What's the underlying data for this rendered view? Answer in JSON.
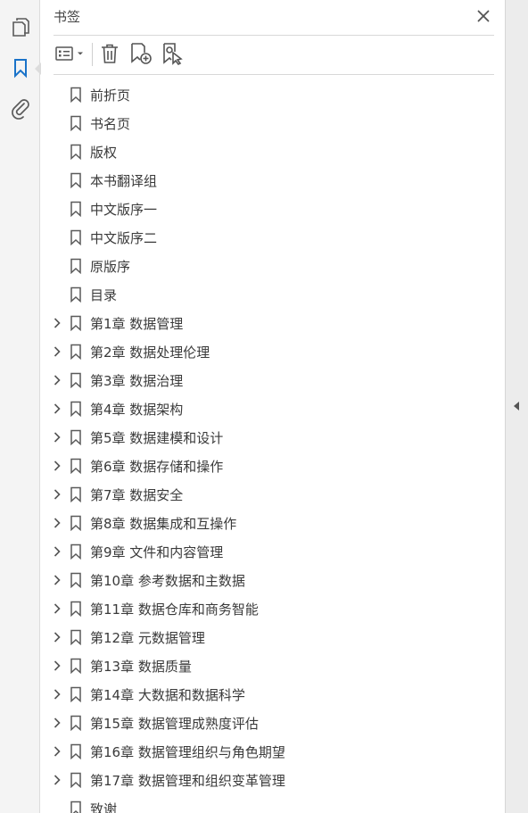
{
  "rail": {
    "pages_icon": "pages-icon",
    "bookmarks_icon": "bookmark-icon",
    "attachments_icon": "paperclip-icon"
  },
  "panel": {
    "title": "书签",
    "close_icon": "close-icon"
  },
  "toolbar": {
    "options_icon": "list-options-icon",
    "delete_icon": "trash-icon",
    "new_bookmark_icon": "new-bookmark-icon",
    "new_from_selection_icon": "bookmark-from-selection-icon"
  },
  "bookmarks": [
    {
      "label": "前折页",
      "expandable": false
    },
    {
      "label": "书名页",
      "expandable": false
    },
    {
      "label": "版权",
      "expandable": false
    },
    {
      "label": "本书翻译组",
      "expandable": false
    },
    {
      "label": "中文版序一",
      "expandable": false
    },
    {
      "label": "中文版序二",
      "expandable": false
    },
    {
      "label": "原版序",
      "expandable": false
    },
    {
      "label": "目录",
      "expandable": false
    },
    {
      "label": "第1章 数据管理",
      "expandable": true
    },
    {
      "label": "第2章 数据处理伦理",
      "expandable": true
    },
    {
      "label": "第3章 数据治理",
      "expandable": true
    },
    {
      "label": "第4章 数据架构",
      "expandable": true
    },
    {
      "label": "第5章 数据建模和设计",
      "expandable": true
    },
    {
      "label": "第6章 数据存储和操作",
      "expandable": true
    },
    {
      "label": "第7章 数据安全",
      "expandable": true
    },
    {
      "label": "第8章 数据集成和互操作",
      "expandable": true
    },
    {
      "label": "第9章 文件和内容管理",
      "expandable": true
    },
    {
      "label": "第10章 参考数据和主数据",
      "expandable": true
    },
    {
      "label": "第11章 数据仓库和商务智能",
      "expandable": true
    },
    {
      "label": "第12章 元数据管理",
      "expandable": true
    },
    {
      "label": "第13章 数据质量",
      "expandable": true
    },
    {
      "label": "第14章 大数据和数据科学",
      "expandable": true
    },
    {
      "label": "第15章 数据管理成熟度评估",
      "expandable": true
    },
    {
      "label": "第16章 数据管理组织与角色期望",
      "expandable": true
    },
    {
      "label": "第17章 数据管理和组织变革管理",
      "expandable": true
    },
    {
      "label": "致谢",
      "expandable": false
    }
  ],
  "colors": {
    "accent": "#1a73c9",
    "icon": "#5a5a5a"
  }
}
